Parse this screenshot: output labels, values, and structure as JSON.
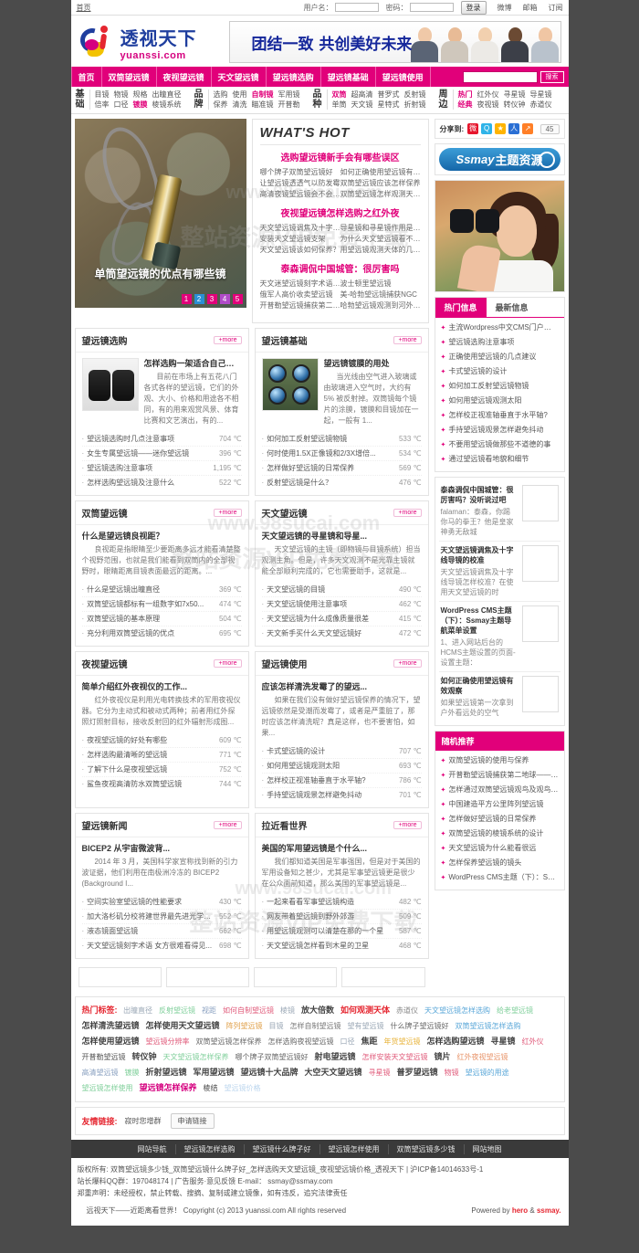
{
  "topbar": {
    "home": "首页",
    "username_label": "用户名：",
    "password_label": "密码：",
    "login_button": "登录",
    "links": [
      "微博",
      "邮箱",
      "订阅"
    ]
  },
  "header": {
    "logo_cn": "透视天下",
    "logo_en": "yuanssi.com",
    "banner_text": "团结一致 共创美好未来"
  },
  "nav": {
    "items": [
      "首页",
      "双筒望远镜",
      "夜视望远镜",
      "天文望远镜",
      "望远镜选购",
      "望远镜基础",
      "望远镜使用"
    ],
    "search_placeholder": "",
    "search_button": "搜索"
  },
  "subnav": [
    {
      "title_top": "基",
      "title_bottom": "础",
      "line1": [
        {
          "t": "目镜"
        },
        {
          "t": "物镜"
        },
        {
          "t": "规格"
        },
        {
          "t": "出瞳直径"
        }
      ],
      "line2": [
        {
          "t": "倍率"
        },
        {
          "t": "口径"
        },
        {
          "t": "镀膜",
          "hot": true
        },
        {
          "t": "棱镜系统"
        }
      ]
    },
    {
      "title_top": "品",
      "title_bottom": "牌",
      "line1": [
        {
          "t": "选购"
        },
        {
          "t": "使用"
        },
        {
          "t": "自制镜",
          "hot": true
        },
        {
          "t": "军用镜"
        }
      ],
      "line2": [
        {
          "t": "保养"
        },
        {
          "t": "清洗"
        },
        {
          "t": "瞄准镜"
        },
        {
          "t": "开普勒"
        }
      ]
    },
    {
      "title_top": "品",
      "title_bottom": "种",
      "line1": [
        {
          "t": "双筒",
          "hot": true
        },
        {
          "t": "超高清"
        },
        {
          "t": "普罗式"
        },
        {
          "t": "反射镜"
        }
      ],
      "line2": [
        {
          "t": "单筒"
        },
        {
          "t": "天文镜"
        },
        {
          "t": "星特式"
        },
        {
          "t": "折射镜"
        }
      ]
    },
    {
      "title_top": "周",
      "title_bottom": "边",
      "line1": [
        {
          "t": "热门",
          "hot": true
        },
        {
          "t": "红外仪"
        },
        {
          "t": "寻星镜"
        },
        {
          "t": "导星镜"
        }
      ],
      "line2": [
        {
          "t": "经典",
          "hot": true
        },
        {
          "t": "夜视镜"
        },
        {
          "t": "转仪钟"
        },
        {
          "t": "赤道仪"
        }
      ]
    }
  ],
  "hero": {
    "caption": "单筒望远镜的优点有哪些镜",
    "dots": [
      "1",
      "2",
      "3",
      "4",
      "5"
    ],
    "whats_hot": "WHAT'S HOT",
    "blocks": [
      {
        "title": "选购望远镜新手会有哪些误区",
        "links": [
          "哪个牌子双筒望远镜好",
          "如何正确使用望远镜有效观察",
          "让望远镜透透气以防发霉",
          "双筒望远镜应该怎样保养",
          "高清夜镜望远镜会不会三问题",
          "双筒望远镜怎样观测天体舒服"
        ]
      },
      {
        "title": "夜视望远镜怎样选购之红外夜",
        "links": [
          "天文望远镜调焦及十字线导镜",
          "导星镜和寻星镜作用是什么",
          "安装天文望远镜支架",
          "为什么天文望远镜看不见目标",
          "天文望远镜该如何保养？",
          "用望远镜观测天体的几点建议"
        ]
      },
      {
        "title": "泰森调侃中国城管：很厉害吗",
        "links": [
          "天文迷望远镜刻字术语 女方",
          "波士顿里望远镜",
          "俄军人高价收卖望远镜",
          "美-哈勃望远镜捕获NGC",
          "开普勒望远镜捕获第二地球——",
          "哈勃望远镜观测到河外星系明"
        ]
      }
    ]
  },
  "sidebar": {
    "share_label": "分享到:",
    "share_icons": [
      "weibo-icon",
      "qzone-icon",
      "favorite-icon",
      "renren-icon",
      "more-share-icon"
    ],
    "share_count": "45",
    "ssmay_banner_text1": "Ssmay",
    "ssmay_banner_text2": "主题资源",
    "tabs": [
      {
        "label": "热门信息",
        "active": true
      },
      {
        "label": "最新信息",
        "active": false
      }
    ],
    "hot_list": [
      "主流Wordpress中文CMS门户主题：...",
      "望远镜选购注意事项",
      "正确使用望远镜的几点建议",
      "卡式望远镜的设计",
      "如何加工反射望远镜物镜",
      "如何用望远镜观测太阳",
      "怎样校正视准轴垂直于水平轴?",
      "手持望远镜观景怎样避免抖动",
      "不要用望远镜做那些不道德的事",
      "通过望远镜看地貌和细节"
    ],
    "news": [
      {
        "title": "泰森调侃中国城管：很厉害吗？没听说过吧",
        "desc": "falaman：泰森，你踢你马的拳王？他是皇家神勇无敌城"
      },
      {
        "title": "天文望远镜调焦及十字线导镜的校准",
        "desc": "天文望远镜调焦及十字线导镜怎样校准？在使用天文望远镜的时"
      },
      {
        "title": "WordPress CMS主题（下）：Ssmay主题导航菜单设置",
        "desc": "1、进入网站后台的HCMS主题设置的页面-设置主题："
      },
      {
        "title": "如何正确使用望远镜有效观察",
        "desc": "如果望远镜第一次拿到户外看远处的空气"
      }
    ],
    "rec_title": "随机推荐",
    "rec_list": [
      "双筒望远镜的使用与保养",
      "开普勒望远镜捕获第二地球——做如行...",
      "怎样通过双筒望远镜观鸟及观鸟常识",
      "中国建造平方公里阵列望远镜",
      "怎样做好望远镜的日常保养",
      "双筒望远镜的棱镜系统的设计",
      "天文望远镜为什么能看很远",
      "怎样保养望远镜的镜头",
      "WordPress CMS主题（下）：Ssm..."
    ]
  },
  "sections": [
    {
      "title": "望远镜选购",
      "more": "+more",
      "pic": "bino",
      "article_title": "怎样选购一架适合自己的望...",
      "article_desc": "目前在市场上有五花八门各式各样的望远镜，它们的外观、大小、价格和用途各不相同，有的用来观赏风景、体育比赛和文艺演出，有的...",
      "items": [
        {
          "t": "望远镜选购时几点注意事项",
          "v": "704 ℃"
        },
        {
          "t": "女生专属望远镜——迷你望远镜",
          "v": "396 ℃"
        },
        {
          "t": "望远镜选购注意事项",
          "v": "1,195 ℃"
        },
        {
          "t": "怎样选购望远镜及注意什么",
          "v": "522 ℃"
        }
      ]
    },
    {
      "title": "望远镜基础",
      "more": "+more",
      "pic": "lens",
      "article_title": "望远镜镀膜的用处",
      "article_desc": "当光线由空气进入玻璃或由玻璃进入空气时，大约有 5% 被反射掉。双筒镜每个镜片的涂膜，镀膜和目镜加在一起，一般有 1...",
      "items": [
        {
          "t": "如何加工反射望远镜物镜",
          "v": "533 ℃"
        },
        {
          "t": "何时使用1.5X正像镜和2/3X增倍...",
          "v": "534 ℃"
        },
        {
          "t": "怎样做好望远镜的日常保养",
          "v": "569 ℃"
        },
        {
          "t": "反射望远镜是什么？",
          "v": "476 ℃"
        }
      ]
    },
    {
      "title": "双筒望远镜",
      "more": "+more",
      "pic": "none",
      "article_title": "什么是望远镜良视距？",
      "article_desc": "良视距是指眼睛至少要距离多远才能看清楚整个视野范围，也就是我们能看到双筒内的全部视野时，眼睛距离目镜表面最远的距离。...",
      "items": [
        {
          "t": "什么是望远镜出瞳直径",
          "v": "369 ℃"
        },
        {
          "t": "双筒望远镜都标有一组数字如7x50...",
          "v": "474 ℃"
        },
        {
          "t": "双筒望远镜的基本原理",
          "v": "504 ℃"
        },
        {
          "t": "充分利用双筒望远镜的优点",
          "v": "695 ℃"
        }
      ]
    },
    {
      "title": "天文望远镜",
      "more": "+more",
      "pic": "none",
      "article_title": "天文望远镜的寻星镜和导星...",
      "article_desc": "天文望远镜的主镜（即物镜与目镜系统）担当观测主角。但是，许多天文观测不是光靠主镜就能全部顺利完成的，它也需要助手，这就是...",
      "items": [
        {
          "t": "天文望远镜的目镜",
          "v": "490 ℃"
        },
        {
          "t": "天文望远镜使用注意事项",
          "v": "462 ℃"
        },
        {
          "t": "天文望远镜为什么成像质量很差",
          "v": "415 ℃"
        },
        {
          "t": "天文新手买什么天文望远镜好",
          "v": "472 ℃"
        }
      ]
    },
    {
      "title": "夜视望远镜",
      "more": "+more",
      "pic": "none",
      "article_title": "简单介绍红外夜视仪的工作...",
      "article_desc": "红外夜视仪是利用光电转换技术的军用夜视仪器。它分为主动式和被动式两种；前者用红外探照灯照射目标，接收反射回的红外辐射形成图...",
      "items": [
        {
          "t": "夜视望远镜的好处有哪些",
          "v": "609 ℃"
        },
        {
          "t": "怎样选购最清晰的望远镜",
          "v": "771 ℃"
        },
        {
          "t": "了解下什么是夜视望远镜",
          "v": "752 ℃"
        },
        {
          "t": "鲨鱼夜视高清防水双筒望远镜",
          "v": "744 ℃"
        }
      ]
    },
    {
      "title": "望远镜使用",
      "more": "+more",
      "pic": "none",
      "article_title": "应该怎样清洗发霉了的望远...",
      "article_desc": "如果在我们没有做好望远镜保养的情况下，望远镜依然是受潮而发霉了，或者是严重脏了，那时应该怎样清洗呢？真是这样，也不要害怕，如果...",
      "items": [
        {
          "t": "卡式望远镜的设计",
          "v": "707 ℃"
        },
        {
          "t": "如何用望远镜观测太阳",
          "v": "693 ℃"
        },
        {
          "t": "怎样校正视准轴垂直于水平轴?",
          "v": "786 ℃"
        },
        {
          "t": "手持望远镜观景怎样避免抖动",
          "v": "701 ℃"
        }
      ]
    },
    {
      "title": "望远镜新闻",
      "more": "+more",
      "pic": "none",
      "article_title": "BICEP2 从宇宙微波背...",
      "article_desc": "2014 年 3 月，美国科学家宣称找到新的引力波证据，他们利用在南极洲冷冻的 BICEP2 (Background I...",
      "items": [
        {
          "t": "空间实验室望远镜的性能要求",
          "v": "430 ℃"
        },
        {
          "t": "加大洛杉矶分校将建世界最先进光学望...",
          "v": "552 ℃"
        },
        {
          "t": "液态镜面望远镜",
          "v": "662 ℃"
        },
        {
          "t": "天文望远镜刻字术语 女方很难看得见...",
          "v": "698 ℃"
        }
      ]
    },
    {
      "title": "拉近看世界",
      "more": "+more",
      "pic": "none",
      "article_title": "美国的军用望远镜是个什么...",
      "article_desc": "我们都知道美国是军事强国，但是对于美国的军用设备知之甚少，尤其是军事望远镜更是很少在公众面前知道，那么美国的军事望远镜是...",
      "items": [
        {
          "t": "一起来看看军事望远镜构造",
          "v": "482 ℃"
        },
        {
          "t": "网友带着望远镜到野外郊游",
          "v": "509 ℃"
        },
        {
          "t": "用望远镜观测可以清楚在那的一个星",
          "v": "587 ℃"
        },
        {
          "t": "天文望远镜怎样看到木星的卫星",
          "v": "468 ℃"
        }
      ]
    }
  ],
  "tagcloud": {
    "label": "热门标签:",
    "tags": [
      {
        "t": "出瞳直径",
        "c": "#9aa7b5",
        "s": 8
      },
      {
        "t": "反射望远镜",
        "c": "#7fcf9a",
        "s": 8
      },
      {
        "t": "视距",
        "c": "#8aa0c0",
        "s": 8
      },
      {
        "t": "如何自制望远镜",
        "c": "#e05a7a",
        "s": 8
      },
      {
        "t": "棱镜",
        "c": "#9aa7b5",
        "s": 8
      },
      {
        "t": "放大倍数",
        "c": "#444",
        "s": 9
      },
      {
        "t": "如何观测天体",
        "c": "#e52630",
        "s": 9
      },
      {
        "t": "赤道仪",
        "c": "#888",
        "s": 8
      },
      {
        "t": "天文望远镜怎样选购",
        "c": "#5aa7d8",
        "s": 8
      },
      {
        "t": "给老望远镜",
        "c": "#7fcf9a",
        "s": 8
      },
      {
        "t": "怎样清洗望远镜",
        "c": "#444",
        "s": 9
      },
      {
        "t": "怎样使用天文望远镜",
        "c": "#444",
        "s": 9
      },
      {
        "t": "阵列望远镜",
        "c": "#e0a04a",
        "s": 8
      },
      {
        "t": "目镜",
        "c": "#9aa7b5",
        "s": 8
      },
      {
        "t": "怎样自制望远镜",
        "c": "#777",
        "s": 8
      },
      {
        "t": "望有望远镜",
        "c": "#9aa7b5",
        "s": 8
      },
      {
        "t": "什么牌子望远镜好",
        "c": "#666",
        "s": 8
      },
      {
        "t": "双筒望远镜怎样选购",
        "c": "#5aa7d8",
        "s": 8
      },
      {
        "t": "怎样使用望远镜",
        "c": "#444",
        "s": 9
      },
      {
        "t": "望远镜分辨率",
        "c": "#e05a7a",
        "s": 8
      },
      {
        "t": "双筒望远镜怎样保养",
        "c": "#666",
        "s": 8
      },
      {
        "t": "怎样选购夜视望远镜",
        "c": "#666",
        "s": 8
      },
      {
        "t": "口径",
        "c": "#9aa7b5",
        "s": 8
      },
      {
        "t": "焦距",
        "c": "#444",
        "s": 9
      },
      {
        "t": "年货望远镜",
        "c": "#e8b33a",
        "s": 8
      },
      {
        "t": "怎样选购望远镜",
        "c": "#444",
        "s": 9
      },
      {
        "t": "寻星镜",
        "c": "#444",
        "s": 9
      },
      {
        "t": "红外仪",
        "c": "#e05a7a",
        "s": 8
      },
      {
        "t": "开普勒望远镜",
        "c": "#555",
        "s": 8
      },
      {
        "t": "转仪钟",
        "c": "#444",
        "s": 9
      },
      {
        "t": "天文望远镜怎样保养",
        "c": "#7fcf9a",
        "s": 8
      },
      {
        "t": "哪个牌子双筒望远镜好",
        "c": "#666",
        "s": 8
      },
      {
        "t": "射电望远镜",
        "c": "#444",
        "s": 9
      },
      {
        "t": "怎样安装天文望远镜",
        "c": "#e05a7a",
        "s": 8
      },
      {
        "t": "镜片",
        "c": "#444",
        "s": 9
      },
      {
        "t": "红外夜视望远镜",
        "c": "#e8946a",
        "s": 8
      },
      {
        "t": "高清望远镜",
        "c": "#8aa0c0",
        "s": 8
      },
      {
        "t": "镀膜",
        "c": "#7fcf9a",
        "s": 8
      },
      {
        "t": "折射望远镜",
        "c": "#444",
        "s": 9
      },
      {
        "t": "军用望远镜",
        "c": "#444",
        "s": 9
      },
      {
        "t": "望远镜十大品牌",
        "c": "#444",
        "s": 9
      },
      {
        "t": "大空天文望远镜",
        "c": "#444",
        "s": 9
      },
      {
        "t": "寻星镜",
        "c": "#e05a7a",
        "s": 8
      },
      {
        "t": "普罗望远镜",
        "c": "#444",
        "s": 9
      },
      {
        "t": "物镜",
        "c": "#e05a7a",
        "s": 8
      },
      {
        "t": "望远镜的用途",
        "c": "#5aa7d8",
        "s": 8
      },
      {
        "t": "望远镜怎样使用",
        "c": "#7fcf9a",
        "s": 8
      },
      {
        "t": "望远镜怎样保养",
        "c": "#d5007f",
        "s": 9
      },
      {
        "t": "棱结",
        "c": "#444",
        "s": 8
      },
      {
        "t": "望远镜价格",
        "c": "#bcd6ee",
        "s": 8
      }
    ]
  },
  "friend": {
    "label": "友情链接:",
    "note": "寂时您增群",
    "apply": "申请链接"
  },
  "footer": {
    "nav": [
      "网站导航",
      "望远镜怎样选购",
      "望远镜什么牌子好",
      "望远镜怎样使用",
      "双筒望远镜多少钱",
      "网站地图"
    ],
    "line1": "版权所有: 双筒望远镜多少钱_双筒望远镜什么牌子好_怎样选购天文望远镜_夜视望远镜价格_透视天下 | 沪ICP备14014633号-1",
    "line2": "站长爆料QQ群：197048174 | 广告服务·意见反馈 E-mail： ssmay@ssmay.com",
    "line3": "郑重声明：未经授权，禁止转载、搜摘、复制或建立镜像，如有违反，追究法律责任",
    "line4": "远视天下——近距离看世界！     Copyright (c) 2013 yuanssi.com All rights reserved",
    "powered_prefix": "Powered by ",
    "powered_a": "hero",
    "powered_amp": " & ",
    "powered_b": "ssmay."
  },
  "watermark": {
    "site": "www.98sucai.com",
    "line": "整站资源VIP免费下载"
  },
  "colors": {
    "accent": "#e1007a",
    "blue": "#1f3e9e",
    "red": "#e52630"
  }
}
